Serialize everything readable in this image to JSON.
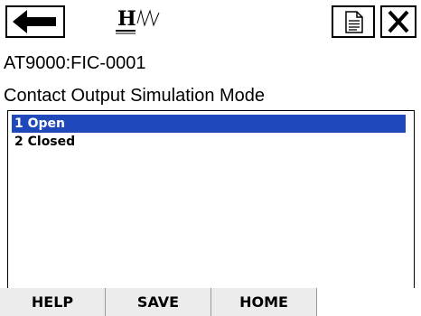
{
  "header": {
    "back_icon": "arrow-left-icon",
    "logo_icon": "hw-logo-icon",
    "doc_icon": "document-icon",
    "close_icon": "close-icon"
  },
  "device_tag": "AT9000:FIC-0001",
  "title": "Contact Output Simulation Mode",
  "list": {
    "items": [
      {
        "label": "1 Open",
        "selected": true
      },
      {
        "label": "2 Closed",
        "selected": false
      }
    ]
  },
  "softkeys": [
    "HELP",
    "SAVE",
    "HOME",
    ""
  ],
  "colors": {
    "selection": "#1f49ba",
    "softkey_bg": "#ececec"
  }
}
